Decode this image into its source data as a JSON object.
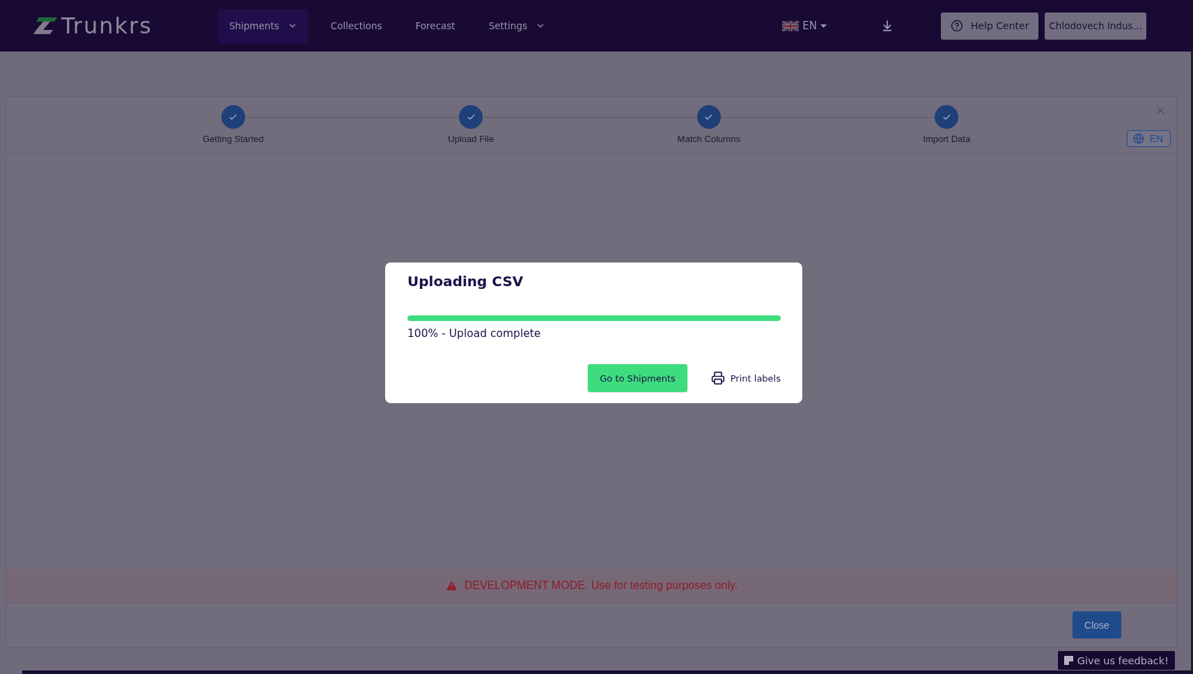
{
  "header": {
    "logo": "Trunkrs",
    "nav": [
      {
        "label": "Shipments",
        "selected": true,
        "has_menu": true
      },
      {
        "label": "Collections",
        "selected": false,
        "has_menu": false
      },
      {
        "label": "Forecast",
        "selected": false,
        "has_menu": false
      },
      {
        "label": "Settings",
        "selected": false,
        "has_menu": true
      }
    ],
    "language": "EN",
    "help_button": "Help Center",
    "account_button": "Chlodovech Indus…"
  },
  "importer": {
    "steps": [
      {
        "label": "Getting Started",
        "completed": true
      },
      {
        "label": "Upload File",
        "completed": true
      },
      {
        "label": "Match Columns",
        "completed": true
      },
      {
        "label": "Import Data",
        "completed": true
      }
    ],
    "language": "EN",
    "banner": "DEVELOPMENT MODE. Use for testing purposes only.",
    "close_button": "Close"
  },
  "dialog": {
    "title": "Uploading CSV",
    "progress": {
      "level": 1
    },
    "status": "100% - Upload complete",
    "primary_button": "Go to Shipments",
    "secondary_button": "Print labels"
  },
  "feedback_button": "Give us feedback!"
}
